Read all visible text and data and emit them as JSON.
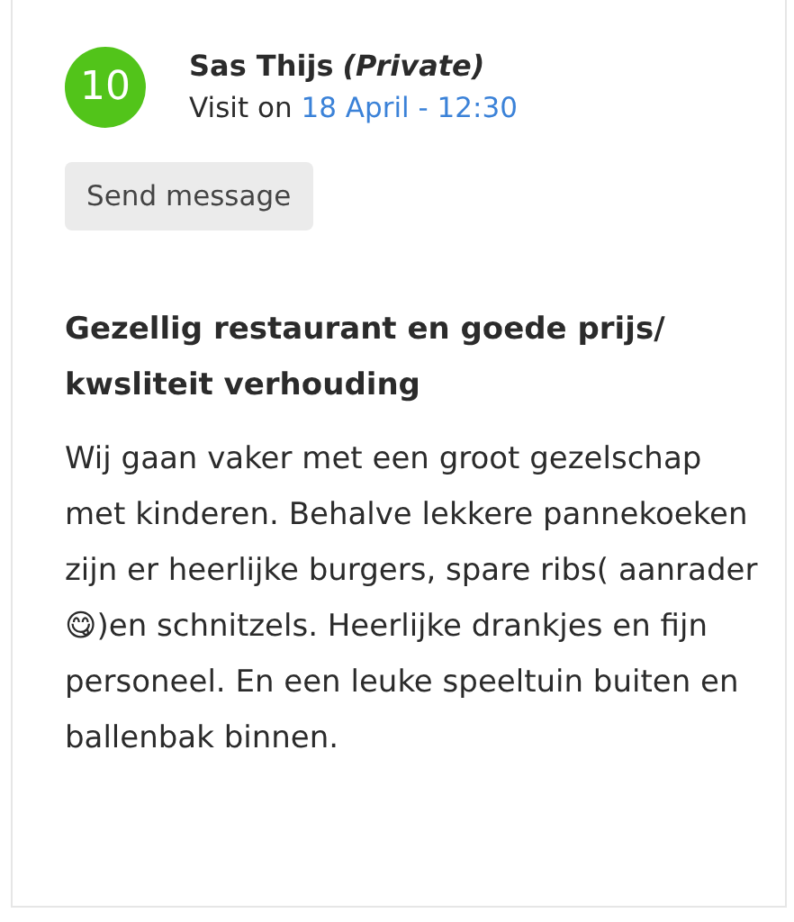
{
  "review": {
    "score": "10",
    "author": "Sas Thijs",
    "author_type": "(Private)",
    "visit_label": "Visit on",
    "visit_date": "18 April - 12:30",
    "button": "Send message",
    "title": "Gezellig restaurant en goede prijs/ kwsliteit verhouding",
    "body": "Wij gaan vaker met een groot gezelschap met kinderen. Behalve lekkere pannekoeken zijn er heerlijke burgers, spare ribs( aanrader😋)en schnitzels. Heerlijke drankjes en fijn personeel. En een leuke speeltuin buiten en ballenbak binnen."
  }
}
